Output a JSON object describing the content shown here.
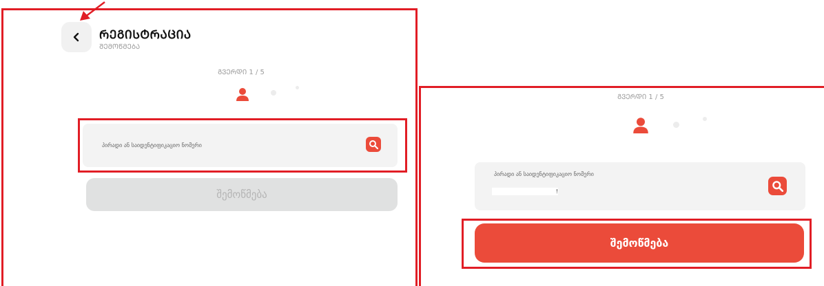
{
  "header": {
    "back_icon": "chevron-left-icon",
    "title": "ᲠᲔᲒᲘᲡᲢᲠᲐᲪᲘᲐ",
    "subtitle": "ᲨᲔᲛᲝᲬᲛᲔᲑᲐ"
  },
  "left": {
    "step": "ᲒᲕᲔᲠᲓᲘ 1 / 5",
    "field_label": "პირადი ან საიდენტიფიკაციო ნომერი",
    "submit_label": "შემოწმება"
  },
  "right": {
    "step": "ᲒᲕᲔᲠᲓᲘ 1 / 5",
    "field_label": "პირადი ან საიდენტიფიკაციო ნომერი",
    "input_value": "!",
    "submit_label": "შემოწმება"
  },
  "colors": {
    "accent": "#eb4b3a",
    "highlight": "#e11d25",
    "disabled_bg": "#e0e1e1"
  },
  "icons": {
    "user": "user-icon",
    "search": "search-icon",
    "annotation_arrow": "arrow-icon"
  }
}
